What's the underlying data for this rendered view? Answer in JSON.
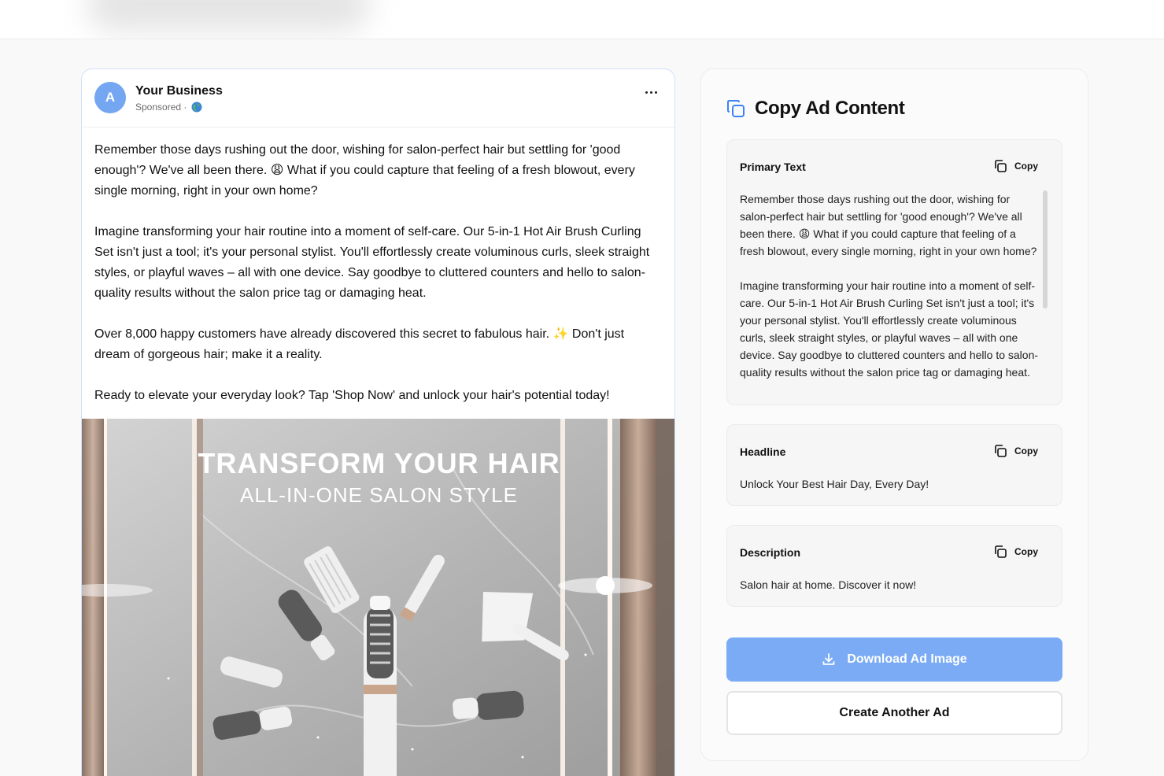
{
  "ad_preview": {
    "avatar_letter": "A",
    "business_name": "Your Business",
    "sponsored_label": "Sponsored ·",
    "primary_text_paragraphs": [
      "Remember those days rushing out the door, wishing for salon-perfect hair but settling for 'good enough'? We've all been there. 😩 What if you could capture that feeling of a fresh blowout, every single morning, right in your own home?",
      "Imagine transforming your hair routine into a moment of self-care. Our 5-in-1 Hot Air Brush Curling Set isn't just a tool; it's your personal stylist. You'll effortlessly create voluminous curls, sleek straight styles, or playful waves – all with one device. Say goodbye to cluttered counters and hello to salon-quality results without the salon price tag or damaging heat.",
      "Over 8,000 happy customers have already discovered this secret to fabulous hair. ✨ Don't just dream of gorgeous hair; make it a reality.",
      "Ready to elevate your everyday look? Tap 'Shop Now' and unlock your hair's potential today!"
    ],
    "image_title": "TRANSFORM YOUR HAIR",
    "image_subtitle": "ALL-IN-ONE SALON STYLE"
  },
  "copy_panel": {
    "title": "Copy Ad Content",
    "copy_label": "Copy",
    "primary_text": {
      "label": "Primary Text",
      "paragraphs": [
        "Remember those days rushing out the door, wishing for salon-perfect hair but settling for 'good enough'? We've all been there. 😩 What if you could capture that feeling of a fresh blowout, every single morning, right in your own home?",
        "Imagine transforming your hair routine into a moment of self-care. Our 5-in-1 Hot Air Brush Curling Set isn't just a tool; it's your personal stylist. You'll effortlessly create voluminous curls, sleek straight styles, or playful waves – all with one device. Say goodbye to cluttered counters and hello to salon-quality results without the salon price tag or damaging heat."
      ]
    },
    "headline": {
      "label": "Headline",
      "value": "Unlock Your Best Hair Day, Every Day!"
    },
    "description": {
      "label": "Description",
      "value": "Salon hair at home. Discover it now!"
    },
    "download_button": "Download Ad Image",
    "create_button": "Create Another Ad"
  },
  "colors": {
    "accent": "#7aabf4",
    "avatar": "#74a6f2",
    "copy_icon": "#3b82f6"
  }
}
